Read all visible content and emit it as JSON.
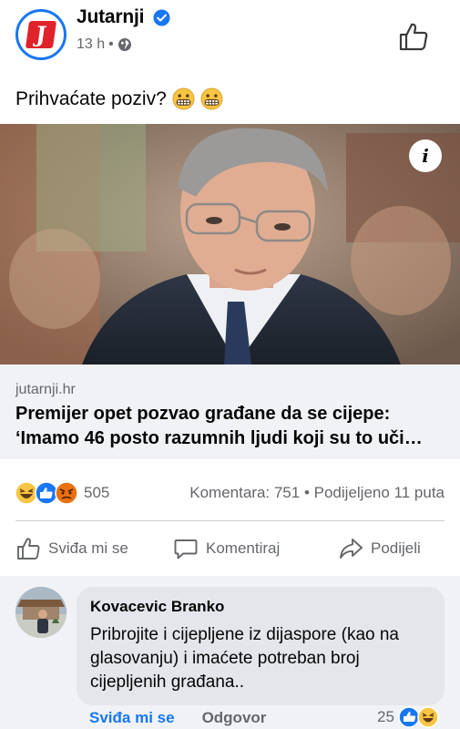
{
  "post": {
    "page_name": "Jutarnji",
    "time": "13 h",
    "separator": "•",
    "logo_letter": "J",
    "text": "Prihvaćate poziv?",
    "emojis": [
      "grimacing-face",
      "grimacing-face"
    ]
  },
  "link": {
    "domain": "jutarnji.hr",
    "title_line1": "Premijer opet pozvao građane da se cijepe:",
    "title_line2": "‘Imamo 46 posto razumnih ljudi koji su to uči…",
    "info_label": "i"
  },
  "reactions": {
    "icons": [
      "haha",
      "like",
      "angry"
    ],
    "count": "505",
    "comments": "Komentara: 751",
    "dot": "•",
    "shares": "Podijeljeno 11 puta"
  },
  "actions": {
    "like": "Sviđa mi se",
    "comment": "Komentiraj",
    "share": "Podijeli"
  },
  "comment": {
    "author": "Kovacevic Branko",
    "text": "Pribrojite i cijepljene iz dijaspore (kao na glasovanju) i imaćete potreban broj cijepljenih građana..",
    "like_label": "Sviđa mi se",
    "reply_label": "Odgovor",
    "reaction_count": "25",
    "reaction_icons": [
      "like",
      "haha"
    ]
  },
  "colors": {
    "brand_blue": "#1877f2",
    "logo_red": "#e0222a",
    "secondary_text": "#65676b",
    "comment_bg": "#f0f2f5"
  }
}
